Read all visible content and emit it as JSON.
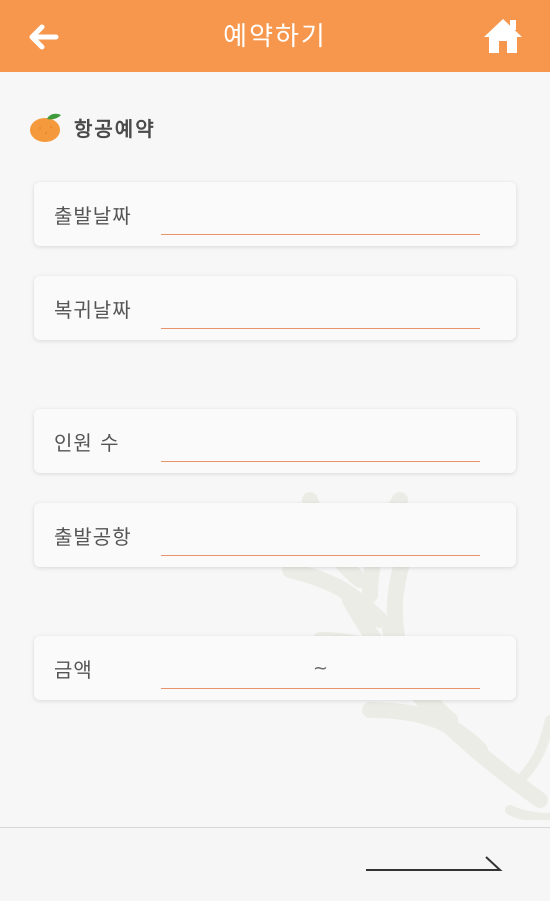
{
  "header": {
    "title": "예약하기",
    "back_icon": "arrow-left-icon",
    "home_icon": "home-icon",
    "color": "#f7974d"
  },
  "section": {
    "icon": "tangerine-icon",
    "title": "항공예약"
  },
  "fields": {
    "departure_date": {
      "label": "출발날짜",
      "value": ""
    },
    "return_date": {
      "label": "복귀날짜",
      "value": ""
    },
    "passengers": {
      "label": "인원 수",
      "value": ""
    },
    "departure_airport": {
      "label": "출발공항",
      "value": ""
    },
    "price": {
      "label": "금액",
      "separator": "~"
    }
  },
  "footer": {
    "next_icon": "long-arrow-right-icon"
  },
  "colors": {
    "underline": "#e8956b",
    "background": "#f7f7f7"
  }
}
